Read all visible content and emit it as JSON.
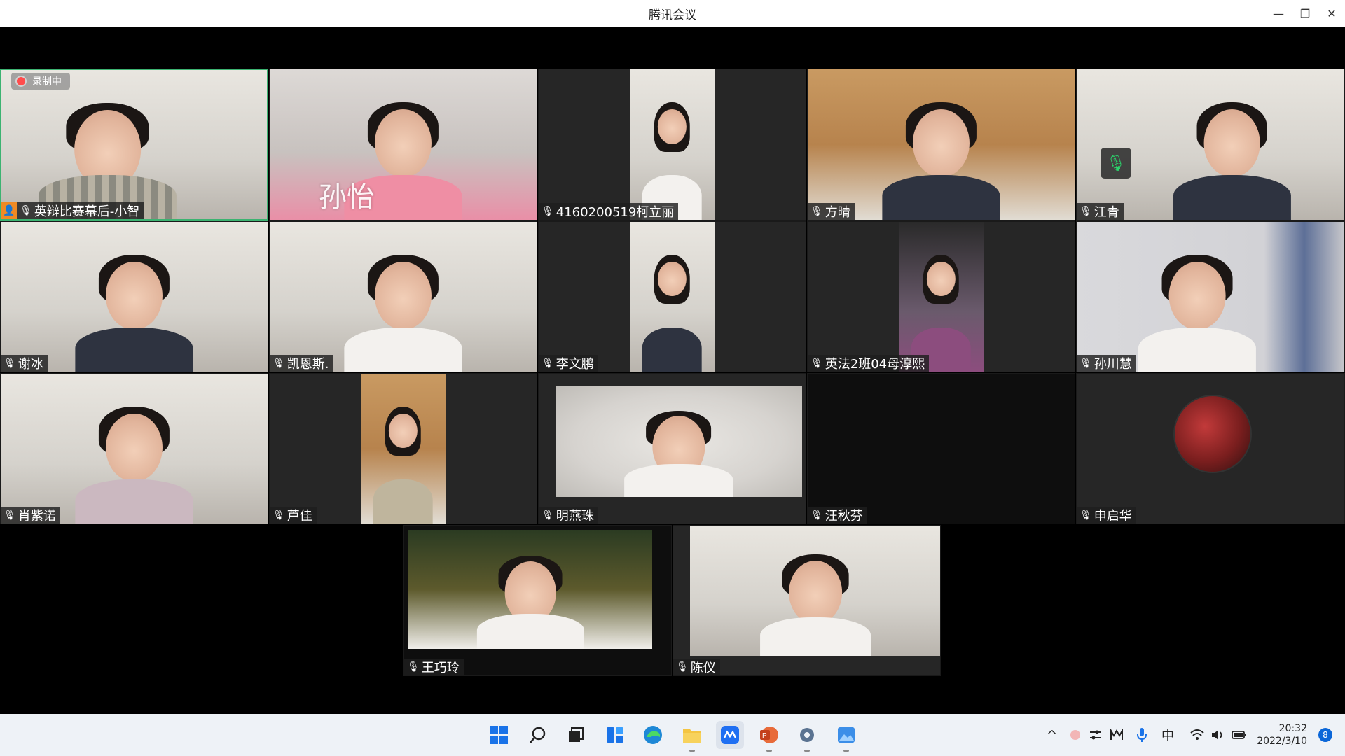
{
  "window": {
    "title": "腾讯会议",
    "minimize_glyph": "—",
    "restore_glyph": "❐",
    "close_glyph": "✕"
  },
  "recording": {
    "label": "录制中"
  },
  "tiles": [
    {
      "name": "英辩比赛幕后-小智",
      "host": true,
      "active_speaker": true
    },
    {
      "name": "",
      "overlay_name": "孙怡"
    },
    {
      "name": "4160200519柯立丽"
    },
    {
      "name": "方晴"
    },
    {
      "name": "江青"
    },
    {
      "name": "谢冰"
    },
    {
      "name": "凯恩斯."
    },
    {
      "name": "李文鹏"
    },
    {
      "name": "英法2班04母淳熙"
    },
    {
      "name": "孙川慧"
    },
    {
      "name": "肖紫诺"
    },
    {
      "name": "芦佳"
    },
    {
      "name": "明燕珠"
    },
    {
      "name": "汪秋芬"
    },
    {
      "name": "申启华"
    },
    {
      "name": "王巧玲"
    },
    {
      "name": "陈仪"
    }
  ],
  "icons": {
    "mic_muted": "🎙",
    "mic_on": "🎙",
    "host_badge": "👤"
  },
  "taskbar": {
    "clock_time": "20:32",
    "clock_date": "2022/3/10",
    "ime_label": "中",
    "notification_count": "8",
    "tray_chevron": "^",
    "apps": [
      "start",
      "search",
      "task-view",
      "widgets",
      "edge",
      "file-explorer",
      "tencent-meeting",
      "powerpoint",
      "settings",
      "photos"
    ]
  },
  "colors": {
    "host_badge": "#f08a24",
    "active_border": "#3cb371",
    "accent": "#0a66d8",
    "rec_dot": "#ff4d4d"
  }
}
